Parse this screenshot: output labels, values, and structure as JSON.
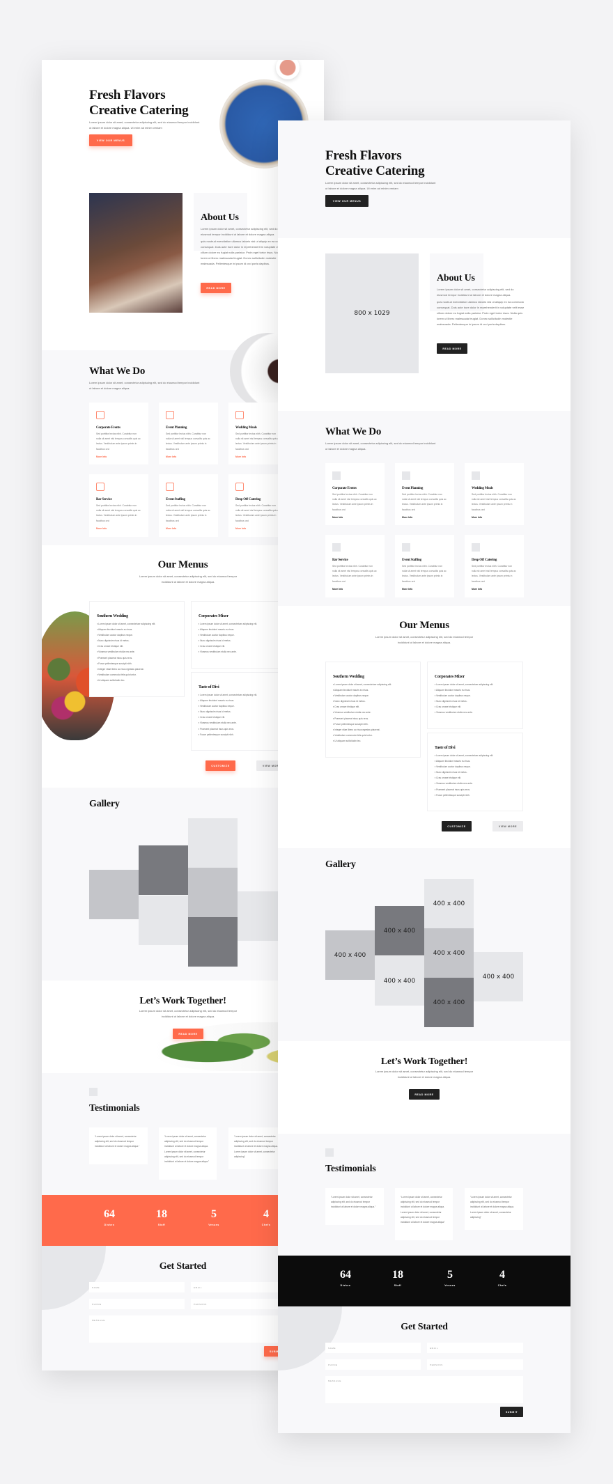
{
  "colors": {
    "accent": "#ff6a4b",
    "dark": "#222222",
    "stats_bg_wireframe": "#0c0c0c",
    "section_bg": "#f8f8fa",
    "placeholder": "#e6e7ea"
  },
  "hero": {
    "title_line1": "Fresh Flavors",
    "title_line2": "Creative Catering",
    "text": "Lorem ipsum dolor sit amet, consectetur adipiscing elit, sed do eiusmod tempor incididunt ut labore et dolore magna aliqua. Ut enim ad minim veniam",
    "button": "View Our Menus"
  },
  "about": {
    "image_placeholder": "800 x 1029",
    "title": "About Us",
    "p1": "Lorem ipsum dolor sit amet, consectetur adipiscing elit, sed do eiusmod tempor incididunt ut labore et dolore magna aliqua.",
    "p2": "quis nostrud exercitation ullamco laboris nisi ut aliquip ex ea commodo consequat. Duis aute irure dolor in reprehenderit in voluptate velit esse cillum dolore eu fugiat nulla pariatur. Proin eget tortor risus. Nulla quis lorem ut libero malesuada feugiat. Donec sollicitudin molestie malesuada. Pellentesque in ipsum id orci porta dapibus.",
    "button": "Read More"
  },
  "what_we_do": {
    "title": "What We Do",
    "text": "Lorem ipsum dolor sit amet, consectetur adipiscing elit, sed do eiusmod tempor incididunt ut labore et dolore magna aliqua.",
    "cards": [
      {
        "title": "Corporate Events",
        "icon": "briefcase-icon",
        "text": "Sed porttitor lectus nibh. Curabitur non nulla sit amet nisl tempus convallis quis ac lectus. Vestibulum ante ipsum primis in faucibus orci",
        "link": "More Info"
      },
      {
        "title": "Event Planning",
        "icon": "calendar-icon",
        "text": "Sed porttitor lectus nibh. Curabitur non nulla sit amet nisl tempus convallis quis ac lectus. Vestibulum ante ipsum primis in faucibus orci",
        "link": "More Info"
      },
      {
        "title": "Wedding Meals",
        "icon": "cake-icon",
        "text": "Sed porttitor lectus nibh. Curabitur non nulla sit amet nisl tempus convallis quis ac lectus. Vestibulum ante ipsum primis in faucibus orci",
        "link": "More Info"
      },
      {
        "title": "Bar Service",
        "icon": "cocktail-icon",
        "text": "Sed porttitor lectus nibh. Curabitur non nulla sit amet nisl tempus convallis quis ac lectus. Vestibulum ante ipsum primis in faucibus orci",
        "link": "More Info"
      },
      {
        "title": "Event Staffing",
        "icon": "staff-icon",
        "text": "Sed porttitor lectus nibh. Curabitur non nulla sit amet nisl tempus convallis quis ac lectus. Vestibulum ante ipsum primis in faucibus orci",
        "link": "More Info"
      },
      {
        "title": "Drop Off Catering",
        "icon": "cloche-icon",
        "text": "Sed porttitor lectus nibh. Curabitur non nulla sit amet nisl tempus convallis quis ac lectus. Vestibulum ante ipsum primis in faucibus orci",
        "link": "More Info"
      }
    ]
  },
  "menus": {
    "title": "Our Menus",
    "text": "Lorem ipsum dolor sit amet, consectetur adipiscing elit, sed do eiusmod tempor incididunt ut labore et dolore magna aliqua.",
    "items": [
      {
        "title": "Southern Wedding",
        "list": [
          "Lorem ipsum dolor sit amet, consectetuer adipiscing elit.",
          "Aliquam tincidunt mauris eu risus.",
          "Vestibulum auctor dapibus neque.",
          "Nunc dignissim risus id metus.",
          "Cras ornare tristique elit.",
          "Vivamus vestibulum ntulla nec ante.",
          "Praesent placerat risus quis eros.",
          "Fusce pellentesque suscipit nibh.",
          "Integer vitae libero ac risus egestas placerat.",
          "Vestibulum commodo felis quis tortor.",
          "Ut aliquam sollicitudin leo."
        ]
      },
      {
        "title": "Corporates Mixer",
        "list": [
          "Lorem ipsum dolor sit amet, consectetuer adipiscing elit.",
          "Aliquam tincidunt mauris eu risus.",
          "Vestibulum auctor dapibus neque.",
          "Nunc dignissim risus id metus.",
          "Cras ornare tristique elit.",
          "Vivamus vestibulum ntulla nec ante."
        ]
      },
      {
        "title": "Taste of Divi",
        "list": [
          "Lorem ipsum dolor sit amet, consectetuer adipiscing elit.",
          "Aliquam tincidunt mauris eu risus.",
          "Vestibulum auctor dapibus neque.",
          "Nunc dignissim risus id metus.",
          "Cras ornare tristique elit.",
          "Vivamus vestibulum ntulla nec ante.",
          "Praesent placerat risus quis eros.",
          "Fusce pellentesque suscipit nibh."
        ]
      }
    ],
    "customize_button": "Customize",
    "view_more_button": "View More"
  },
  "gallery": {
    "title": "Gallery",
    "tile_label": "400 x 400"
  },
  "work": {
    "title": "Let’s Work Together!",
    "text": "Lorem ipsum dolor sit amet, consectetur adipiscing elit, sed do eiusmod tempor incididunt ut labore et dolore magna aliqua.",
    "button": "Read More"
  },
  "testimonials": {
    "title": "Testimonials",
    "items": [
      "“Lorem ipsum dolor sit amet, consectetur adipiscing elit, sed do eiusmod tempor incididunt ut labore et dolore magna aliqua.”",
      "“Lorem ipsum dolor sit amet, consectetur adipiscing elit, sed do eiusmod tempor incididunt ut labore et dolore magna aliqua. Lorem ipsum dolor sit amet, consectetur adipiscing elit, sed do eiusmod tempor incididunt ut labore et dolore magna aliqua.”",
      "“Lorem ipsum dolor sit amet, consectetur adipiscing elit, sed do eiusmod tempor incididunt ut labore et dolore magna aliqua. Lorem ipsum dolor sit amet, consectetur adipiscing”"
    ]
  },
  "stats": [
    {
      "value": "64",
      "label": "Dishes"
    },
    {
      "value": "18",
      "label": "Staff"
    },
    {
      "value": "5",
      "label": "Venues"
    },
    {
      "value": "4",
      "label": "Chefs"
    }
  ],
  "form": {
    "title": "Get Started",
    "name": "Name",
    "email": "Email",
    "phone": "Phone",
    "persons": "Persons",
    "message": "Message",
    "submit": "Submit"
  }
}
